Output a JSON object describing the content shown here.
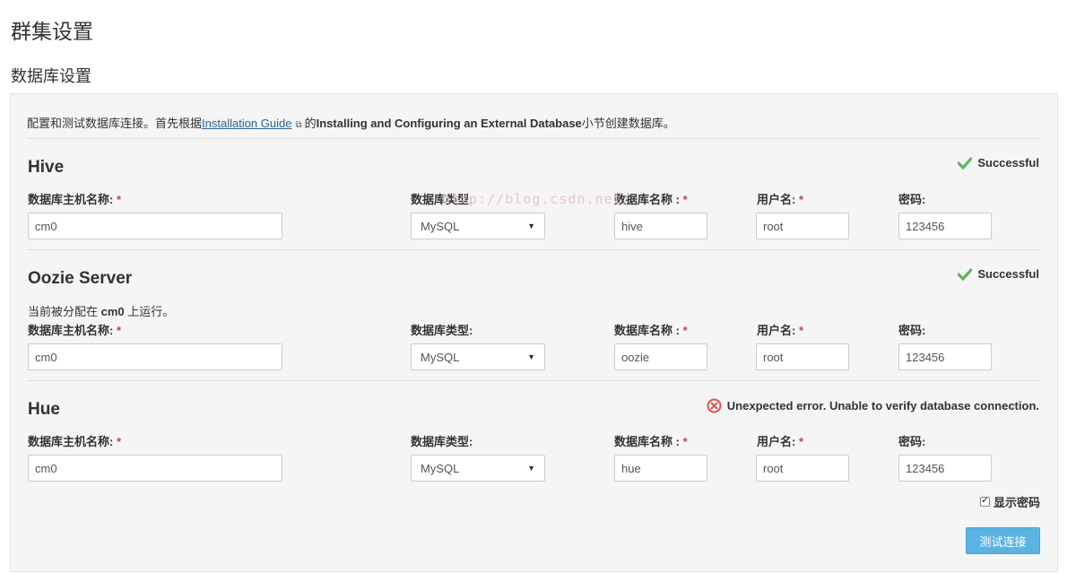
{
  "page": {
    "title": "群集设置",
    "section_title": "数据库设置"
  },
  "intro": {
    "prefix": "配置和测试数据库连接。首先根据",
    "link": "Installation Guide",
    "middle": "的",
    "bold": "Installing and Configuring an External Database",
    "suffix": "小节创建数据库。"
  },
  "labels": {
    "host": "数据库主机名称:",
    "type": "数据库类型:",
    "dbname": "数据库名称 :",
    "user": "用户名:",
    "password": "密码:",
    "required": "*"
  },
  "services": [
    {
      "name": "Hive",
      "status": "Successful",
      "host": "cm0",
      "type": "MySQL",
      "dbname": "hive",
      "user": "root",
      "password": "123456"
    },
    {
      "name": "Oozie Server",
      "status": "Successful",
      "note_prefix": "当前被分配在",
      "note_host": "cm0",
      "note_suffix": "上运行。",
      "host": "cm0",
      "type": "MySQL",
      "dbname": "oozie",
      "user": "root",
      "password": "123456"
    },
    {
      "name": "Hue",
      "status": "Unexpected error. Unable to verify database connection.",
      "host": "cm0",
      "type": "MySQL",
      "dbname": "hue",
      "user": "root",
      "password": "123456"
    }
  ],
  "show_password": {
    "label": "显示密码",
    "checked": true
  },
  "test_button": "测试连接",
  "watermark": "http://blog.csdn.net/",
  "colors": {
    "success": "#5cb85c",
    "error": "#d9534f",
    "button": "#5bb3e3",
    "link": "#2a6496"
  }
}
